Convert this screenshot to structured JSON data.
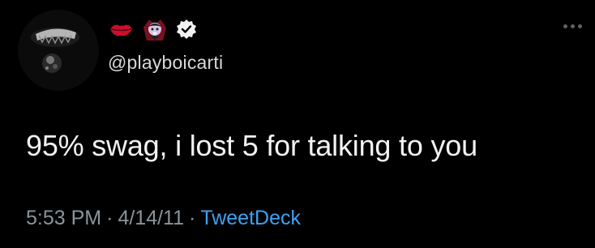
{
  "tweet": {
    "author": {
      "emoji_icons": [
        "kiss-mark-icon",
        "vampire-icon"
      ],
      "verified_icon": "verified-badge-icon",
      "handle": "@playboicarti"
    },
    "more_icon": "more-options-icon",
    "text": "95% swag, i lost 5 for talking to you",
    "meta": {
      "time": "5:53 PM",
      "separator": "·",
      "date": "4/14/11",
      "source": "TweetDeck"
    },
    "colors": {
      "background": "#000000",
      "text": "#f2f2f2",
      "muted": "#8b949b",
      "link": "#3ea2f1"
    }
  }
}
